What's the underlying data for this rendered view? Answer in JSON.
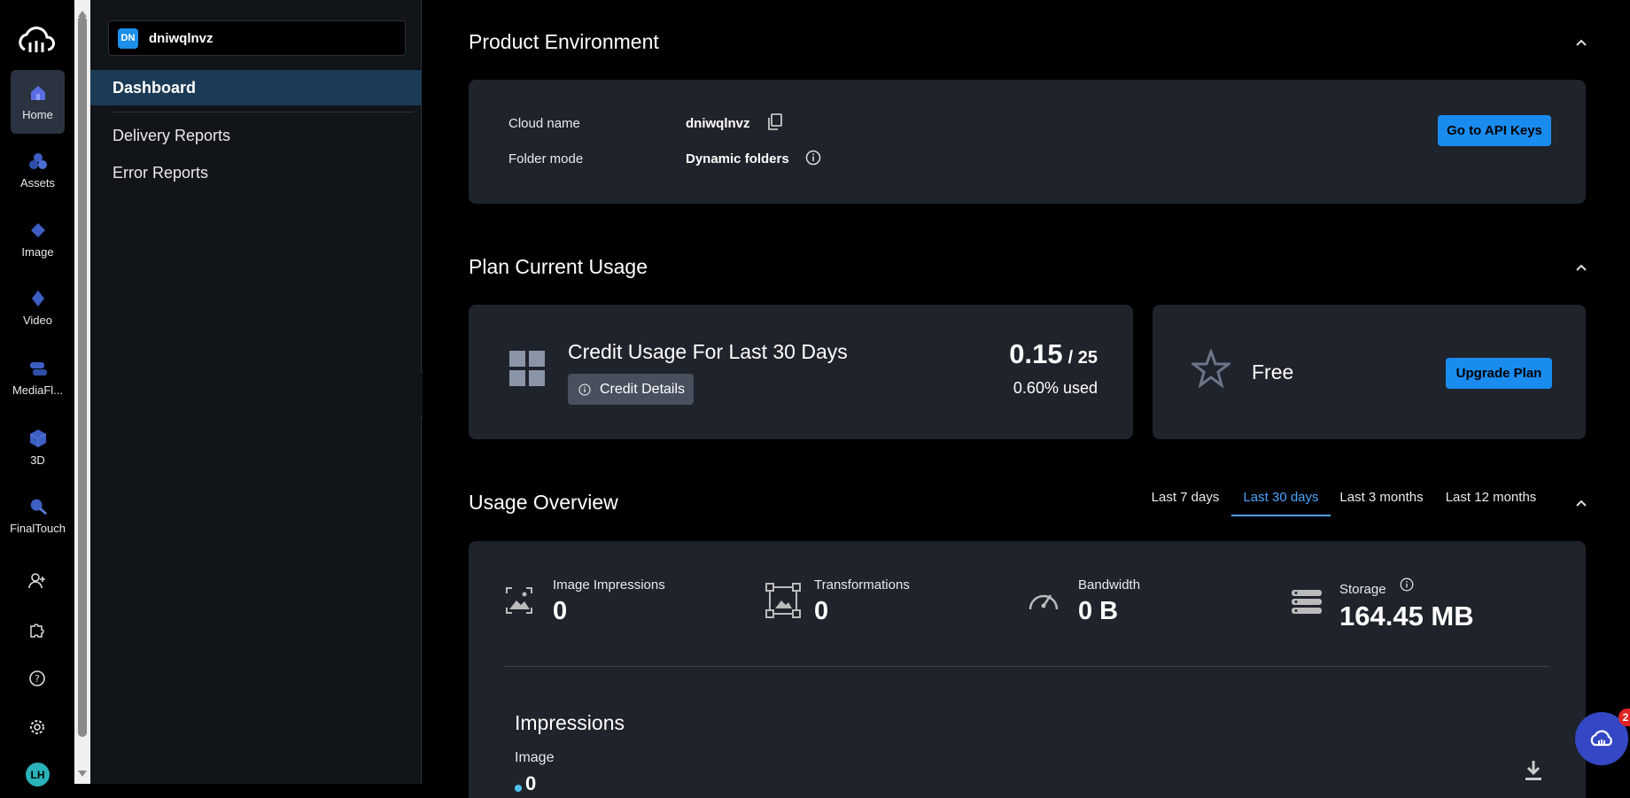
{
  "rail": {
    "items": [
      {
        "label": "Home",
        "icon": "home-icon"
      },
      {
        "label": "Assets",
        "icon": "assets-icon"
      },
      {
        "label": "Image",
        "icon": "image-icon"
      },
      {
        "label": "Video",
        "icon": "video-icon"
      },
      {
        "label": "MediaFl...",
        "icon": "mediaflows-icon"
      },
      {
        "label": "3D",
        "icon": "3d-icon"
      },
      {
        "label": "FinalTouch",
        "icon": "finaltouch-icon"
      }
    ],
    "avatar": "LH"
  },
  "sidebar": {
    "env_badge": "DN",
    "env_name": "dniwqlnvz",
    "items": [
      {
        "label": "Dashboard"
      },
      {
        "label": "Delivery Reports"
      },
      {
        "label": "Error Reports"
      }
    ]
  },
  "product_env": {
    "title": "Product Environment",
    "cloud_name_label": "Cloud name",
    "cloud_name_value": "dniwqlnvz",
    "folder_mode_label": "Folder mode",
    "folder_mode_value": "Dynamic folders",
    "api_button": "Go to API Keys"
  },
  "plan_usage": {
    "title": "Plan Current Usage",
    "credit_title": "Credit Usage For Last 30 Days",
    "credit_details": "Credit Details",
    "used": "0.15",
    "limit": "/ 25",
    "percent": "0.60% used",
    "plan_name": "Free",
    "upgrade_button": "Upgrade Plan"
  },
  "usage_overview": {
    "title": "Usage Overview",
    "tabs": [
      "Last 7 days",
      "Last 30 days",
      "Last 3 months",
      "Last 12 months"
    ],
    "active_tab": "Last 30 days",
    "metrics": [
      {
        "label": "Image Impressions",
        "value": "0"
      },
      {
        "label": "Transformations",
        "value": "0"
      },
      {
        "label": "Bandwidth",
        "value": "0 B"
      },
      {
        "label": "Storage",
        "value": "164.45 MB"
      }
    ],
    "impressions_title": "Impressions",
    "impressions_sub": "Image",
    "impressions_value": "0"
  },
  "chat_badge": "2",
  "colors": {
    "accent": "#1a8cf0",
    "active_nav": "#1b3a55",
    "card": "#1f232b"
  }
}
